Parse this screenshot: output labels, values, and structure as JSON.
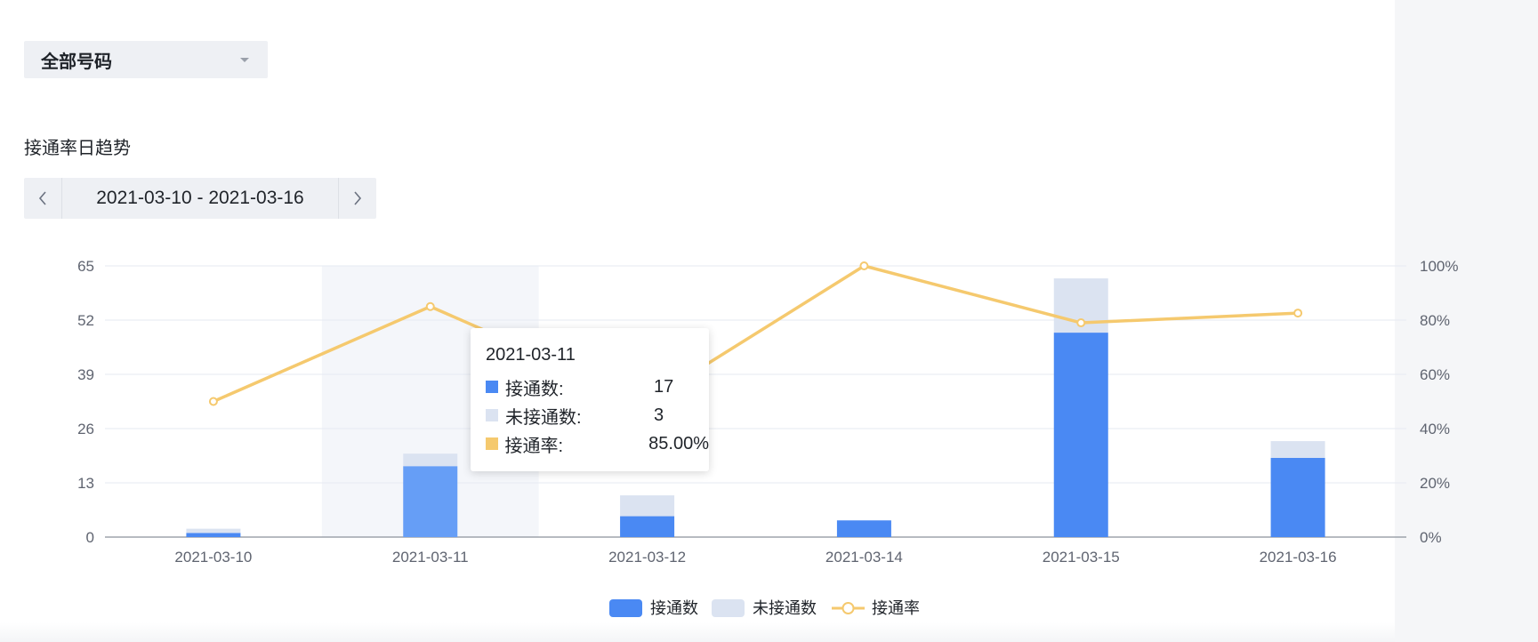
{
  "filter": {
    "selected": "全部号码"
  },
  "section_title": "接通率日趋势",
  "date_range": {
    "label": "2021-03-10 - 2021-03-16"
  },
  "icons": {
    "prev": "chevron-left-icon",
    "next": "chevron-right-icon",
    "dropdown": "caret-down-icon"
  },
  "colors": {
    "connected": "#4a89f3",
    "unconnected": "#dbe3f1",
    "rate": "#f5c96e",
    "highlight": "#f4f6fa"
  },
  "chart_data": {
    "type": "bar",
    "categories": [
      "2021-03-10",
      "2021-03-11",
      "2021-03-12",
      "2021-03-14",
      "2021-03-15",
      "2021-03-16"
    ],
    "series": [
      {
        "name": "接通数",
        "type": "bar",
        "stack": "calls",
        "axis": "left",
        "values": [
          1,
          17,
          5,
          4,
          49,
          19
        ]
      },
      {
        "name": "未接通数",
        "type": "bar",
        "stack": "calls",
        "axis": "left",
        "values": [
          1,
          3,
          5,
          0,
          13,
          4
        ]
      },
      {
        "name": "接通率",
        "type": "line",
        "axis": "right",
        "values": [
          50,
          85,
          50,
          100,
          79,
          82.6
        ]
      }
    ],
    "y_left": {
      "ticks": [
        0,
        13,
        26,
        39,
        52,
        65
      ],
      "range": [
        0,
        65
      ]
    },
    "y_right": {
      "ticks": [
        "0%",
        "20%",
        "40%",
        "60%",
        "80%",
        "100%"
      ],
      "range": [
        0,
        100
      ]
    },
    "highlighted_category": "2021-03-11",
    "legend": [
      "接通数",
      "未接通数",
      "接通率"
    ],
    "legend_position": "bottom-center",
    "grid": true
  },
  "tooltip": {
    "date": "2021-03-11",
    "rows": [
      {
        "label": "接通数:",
        "value": "17",
        "color": "#4a89f3"
      },
      {
        "label": "未接通数:",
        "value": "3",
        "color": "#dbe3f1"
      },
      {
        "label": "接通率:",
        "value": "85.00%",
        "color": "#f5c96e"
      }
    ]
  }
}
